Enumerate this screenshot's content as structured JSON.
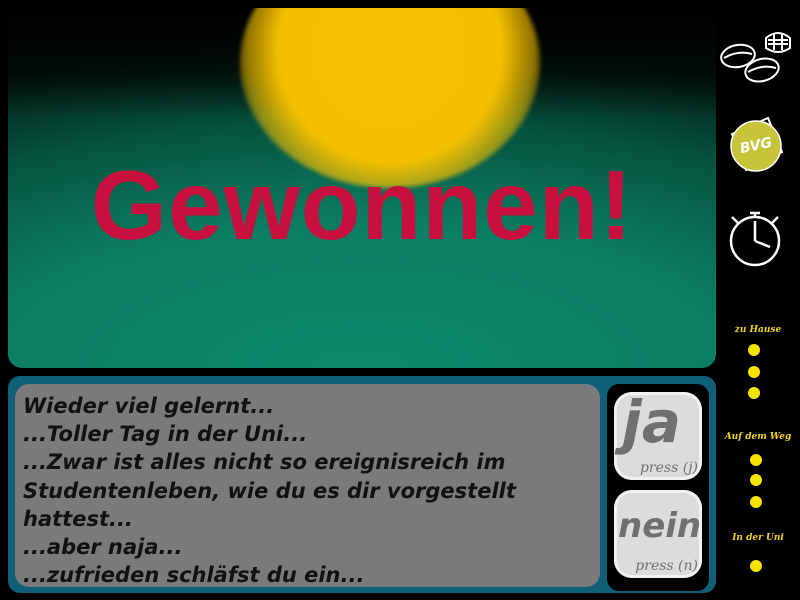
{
  "scene": {
    "headline": "Gewonnen!"
  },
  "message": {
    "lines": [
      "Wieder viel gelernt...",
      "...Toller Tag in der Uni...",
      "...Zwar ist alles nicht so ereignisreich im",
      "Studentenleben, wie du es dir vorgestellt",
      "hattest...",
      "...aber naja...",
      "...zufrieden schläfst du ein..."
    ]
  },
  "choices": {
    "yes": {
      "label": "ja",
      "hint": "press (j)"
    },
    "no": {
      "label": "nein",
      "hint": "press (n)"
    }
  },
  "sidebar": {
    "icons": [
      "food-icon",
      "bvg-ticket-icon",
      "stopwatch-icon"
    ],
    "bvg_text": "BVG",
    "locations": [
      {
        "label": "zu Hause",
        "dots": 3
      },
      {
        "label": "Auf dem Weg",
        "dots": 3
      },
      {
        "label": "In der Uni",
        "dots": 1
      }
    ]
  },
  "colors": {
    "headline": "#c8103e",
    "sun": "#f5c000",
    "scene_green": "#0b7d63",
    "dialog_frame": "#0f5f78",
    "message_box": "#7a7a7a",
    "location_label": "#f5d21a",
    "dot": "#f7e300",
    "bvg_badge": "#c8c43a"
  }
}
